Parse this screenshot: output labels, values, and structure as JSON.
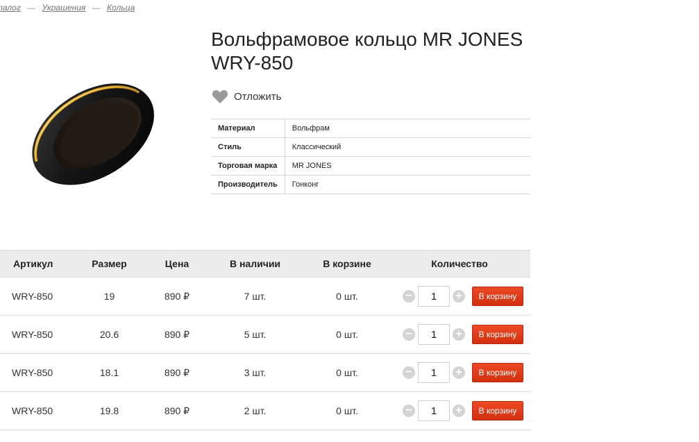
{
  "breadcrumb": {
    "items": [
      "талог",
      "Украшения",
      "Кольца"
    ],
    "separator": "—"
  },
  "product": {
    "title_line1": "Вольфрамовое кольцо MR JONES",
    "title_line2": "WRY-850",
    "wishlist_label": "Отложить"
  },
  "properties": [
    {
      "key": "Материал",
      "value": "Вольфрам"
    },
    {
      "key": "Стиль",
      "value": "Классический"
    },
    {
      "key": "Торговая марка",
      "value": "MR JONES"
    },
    {
      "key": "Производитель",
      "value": "Гонконг"
    }
  ],
  "offers": {
    "headers": {
      "article": "Артикул",
      "size": "Размер",
      "price": "Цена",
      "stock": "В наличии",
      "in_cart": "В корзине",
      "qty": "Количество"
    },
    "rows": [
      {
        "article": "WRY-850",
        "size": "19",
        "price": "890 ₽",
        "stock": "7 шт.",
        "in_cart": "0 шт.",
        "qty": "1",
        "button": "В корзину"
      },
      {
        "article": "WRY-850",
        "size": "20.6",
        "price": "890 ₽",
        "stock": "5 шт.",
        "in_cart": "0 шт.",
        "qty": "1",
        "button": "В корзину"
      },
      {
        "article": "WRY-850",
        "size": "18.1",
        "price": "890 ₽",
        "stock": "3 шт.",
        "in_cart": "0 шт.",
        "qty": "1",
        "button": "В корзину"
      },
      {
        "article": "WRY-850",
        "size": "19.8",
        "price": "890 ₽",
        "stock": "2 шт.",
        "in_cart": "0 шт.",
        "qty": "1",
        "button": "В корзину"
      }
    ]
  },
  "icons": {
    "wishlist": "heart-icon",
    "minus": "minus-icon",
    "plus": "plus-icon"
  },
  "colors": {
    "cart_button": "#e03b17",
    "header_bg": "#ececec",
    "accent_gold": "#d8a020"
  }
}
